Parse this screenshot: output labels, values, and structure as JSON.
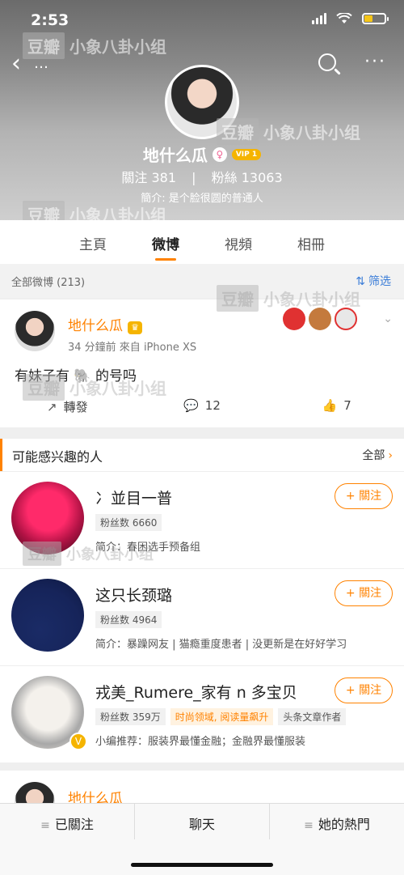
{
  "status_bar": {
    "time": "2:53"
  },
  "header": {
    "name": "地什么瓜",
    "vip_label": "VIP 1",
    "gender_symbol": "♀",
    "stats": {
      "following_label": "關注",
      "following": "381",
      "fans_label": "粉絲",
      "fans": "13063"
    },
    "bio": "簡介: 是个脸很圆的普通人"
  },
  "tabs": [
    "主頁",
    "微博",
    "視頻",
    "相冊"
  ],
  "active_tab": "微博",
  "filter": {
    "title": "全部微博 (213)",
    "label": "筛选"
  },
  "post": {
    "author": "地什么瓜",
    "meta": "34 分鐘前  來自 iPhone XS",
    "text": "有妹子有 🐘 的号吗",
    "repost_label": "轉發",
    "comments": "12",
    "likes": "7"
  },
  "suggestions": {
    "title": "可能感兴趣的人",
    "all_label": "全部",
    "users": [
      {
        "name": "冫並目一普",
        "fans": "粉丝数 6660",
        "bio": "简介：春困选手预备组",
        "follow": "+ 關注"
      },
      {
        "name": "这只长颈璐",
        "fans": "粉丝数 4964",
        "bio": "简介：暴躁网友 | 猫瘾重度患者 | 没更新是在好好学习",
        "follow": "+ 關注"
      },
      {
        "name": "戎美_Rumere_家有 n 多宝贝",
        "fans": "粉丝数 359万",
        "hot_tag": "时尚领域, 阅读量飙升",
        "tag2": "头条文章作者",
        "bio": "小编推荐：服装界最懂金融；金融界最懂服装",
        "follow": "+ 關注"
      }
    ]
  },
  "partial_post": {
    "author": "地什么瓜"
  },
  "bottom_nav": [
    "已關注",
    "聊天",
    "她的熱門"
  ],
  "watermark": {
    "brand": "豆瓣",
    "text": "小象八卦小组"
  },
  "colors": {
    "accent": "#ff8200",
    "link": "#3b7dd8"
  }
}
